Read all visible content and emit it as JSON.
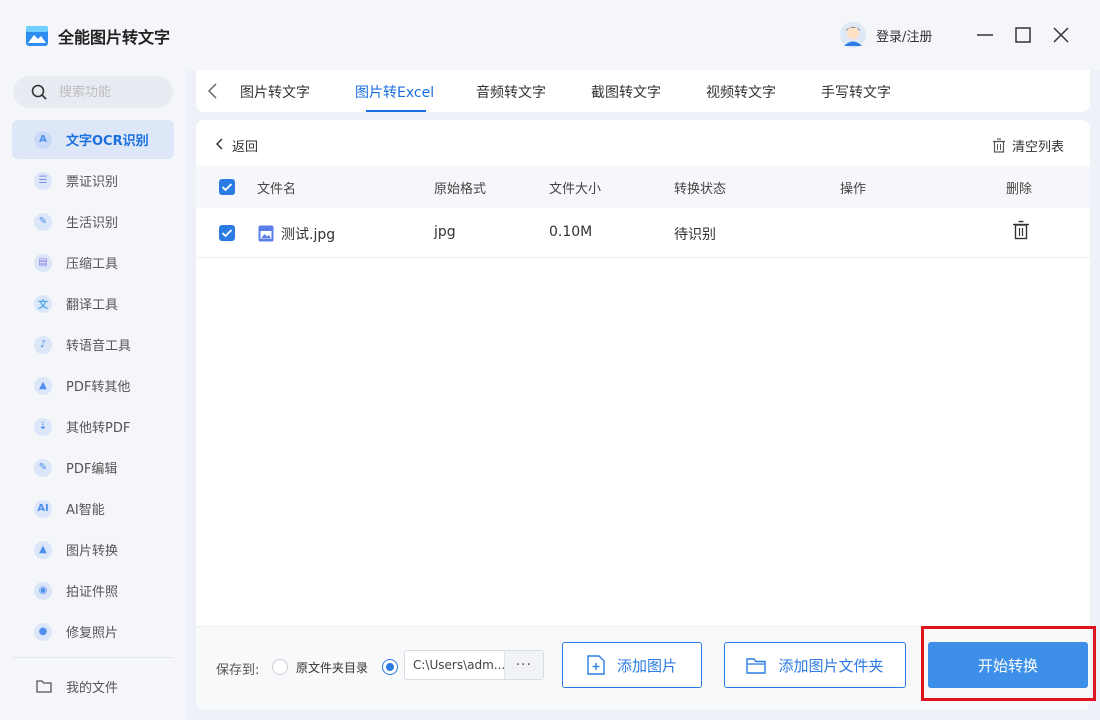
{
  "app": {
    "title": "全能图片转文字",
    "login_label": "登录/注册"
  },
  "sidebar": {
    "search_placeholder": "搜索功能",
    "items": [
      {
        "label": "文字OCR识别",
        "icon": "ocr-letter-icon",
        "glyph": "A",
        "active": true
      },
      {
        "label": "票证识别",
        "icon": "ticket-icon",
        "glyph": "☰",
        "active": false
      },
      {
        "label": "生活识别",
        "icon": "pen-icon",
        "glyph": "✎",
        "active": false
      },
      {
        "label": "压缩工具",
        "icon": "compress-icon",
        "glyph": "▤",
        "active": false
      },
      {
        "label": "翻译工具",
        "icon": "translate-icon",
        "glyph": "文",
        "active": false
      },
      {
        "label": "转语音工具",
        "icon": "music-note-icon",
        "glyph": "♪",
        "active": false
      },
      {
        "label": "PDF转其他",
        "icon": "pdf-icon",
        "glyph": "▲",
        "active": false
      },
      {
        "label": "其他转PDF",
        "icon": "to-pdf-icon",
        "glyph": "⇣",
        "active": false
      },
      {
        "label": "PDF编辑",
        "icon": "pdf-edit-icon",
        "glyph": "✎",
        "active": false
      },
      {
        "label": "AI智能",
        "icon": "ai-icon",
        "glyph": "AI",
        "active": false
      },
      {
        "label": "图片转换",
        "icon": "image-convert-icon",
        "glyph": "▲",
        "active": false
      },
      {
        "label": "拍证件照",
        "icon": "camera-icon",
        "glyph": "◉",
        "active": false
      },
      {
        "label": "修复照片",
        "icon": "repair-photo-icon",
        "glyph": "●",
        "active": false
      }
    ],
    "my_files_label": "我的文件"
  },
  "tabs": [
    {
      "label": "图片转文字",
      "active": false
    },
    {
      "label": "图片转Excel",
      "active": true
    },
    {
      "label": "音频转文字",
      "active": false
    },
    {
      "label": "截图转文字",
      "active": false
    },
    {
      "label": "视频转文字",
      "active": false
    },
    {
      "label": "手写转文字",
      "active": false
    }
  ],
  "panel": {
    "back_label": "返回",
    "clear_label": "清空列表",
    "columns": {
      "name": "文件名",
      "format": "原始格式",
      "size": "文件大小",
      "status": "转换状态",
      "action": "操作",
      "delete": "删除"
    },
    "rows": [
      {
        "name": "测试.jpg",
        "format": "jpg",
        "size": "0.10M",
        "status": "待识别",
        "checked": true
      }
    ]
  },
  "footer": {
    "save_to_label": "保存到:",
    "option_original": "原文件夹目录",
    "path_value": "C:\\Users\\adm...",
    "more_label": "···",
    "add_image_label": "添加图片",
    "add_folder_label": "添加图片文件夹",
    "start_label": "开始转换"
  },
  "colors": {
    "accent": "#2b7be4",
    "primary_button": "#3d8fe8",
    "highlight": "#e0141e"
  }
}
